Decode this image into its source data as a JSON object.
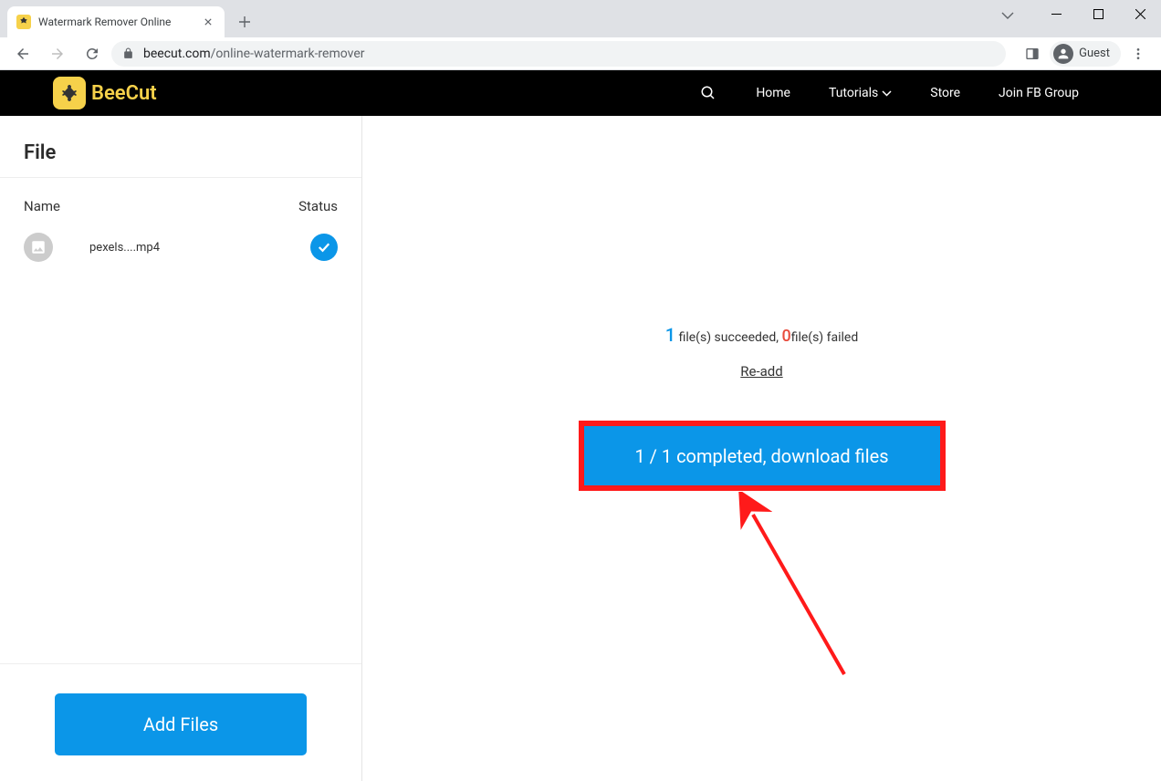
{
  "browser": {
    "tab_title": "Watermark Remover Online",
    "url_domain": "beecut.com",
    "url_path": "/online-watermark-remover",
    "guest_label": "Guest"
  },
  "site": {
    "brand": "BeeCut",
    "nav": {
      "home": "Home",
      "tutorials": "Tutorials",
      "store": "Store",
      "fbgroup": "Join FB Group"
    }
  },
  "sidebar": {
    "title": "File",
    "col_name": "Name",
    "col_status": "Status",
    "files": [
      {
        "name": "pexels....mp4"
      }
    ],
    "add_files": "Add Files"
  },
  "main": {
    "succeeded_count": "1",
    "succeeded_label": " file(s) succeeded, ",
    "failed_count": "0",
    "failed_label": "file(s) failed",
    "readd": "Re-add",
    "download_label": "1 / 1 completed, download files"
  }
}
